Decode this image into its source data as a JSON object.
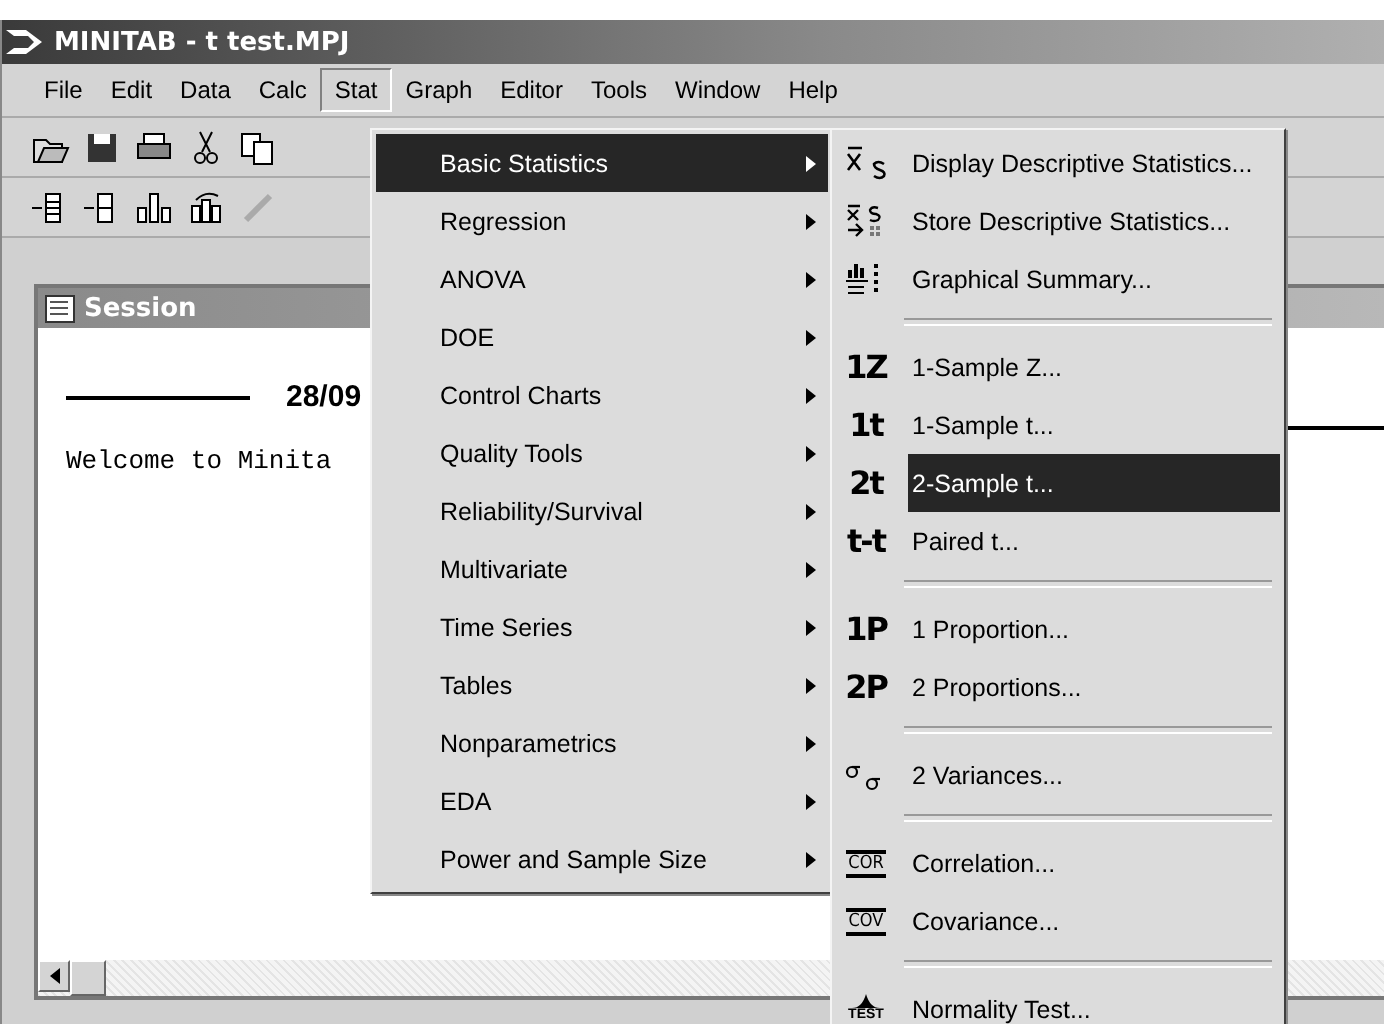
{
  "window": {
    "title": "MINITAB - t test.MPJ"
  },
  "menubar": [
    {
      "label": "File",
      "selected": false
    },
    {
      "label": "Edit",
      "selected": false
    },
    {
      "label": "Data",
      "selected": false
    },
    {
      "label": "Calc",
      "selected": false
    },
    {
      "label": "Stat",
      "selected": true
    },
    {
      "label": "Graph",
      "selected": false
    },
    {
      "label": "Editor",
      "selected": false
    },
    {
      "label": "Tools",
      "selected": false
    },
    {
      "label": "Window",
      "selected": false
    },
    {
      "label": "Help",
      "selected": false
    }
  ],
  "session": {
    "title": "Session",
    "date": "28/09",
    "welcome": "Welcome to Minita"
  },
  "stat_menu": [
    {
      "label": "Basic Statistics",
      "selected": true
    },
    {
      "label": "Regression",
      "selected": false
    },
    {
      "label": "ANOVA",
      "selected": false
    },
    {
      "label": "DOE",
      "selected": false
    },
    {
      "label": "Control Charts",
      "selected": false
    },
    {
      "label": "Quality Tools",
      "selected": false
    },
    {
      "label": "Reliability/Survival",
      "selected": false
    },
    {
      "label": "Multivariate",
      "selected": false
    },
    {
      "label": "Time Series",
      "selected": false
    },
    {
      "label": "Tables",
      "selected": false
    },
    {
      "label": "Nonparametrics",
      "selected": false
    },
    {
      "label": "EDA",
      "selected": false
    },
    {
      "label": "Power and Sample Size",
      "selected": false
    }
  ],
  "basic_statistics_menu": [
    {
      "kind": "xbar-item",
      "label": "Display Descriptive Statistics...",
      "selected": false
    },
    {
      "kind": "store-item",
      "label": "Store Descriptive Statistics...",
      "selected": false
    },
    {
      "kind": "summary-item",
      "label": "Graphical Summary...",
      "selected": false
    },
    {
      "kind": "separator"
    },
    {
      "kind": "item",
      "badge": "1Z",
      "label": "1-Sample Z...",
      "selected": false
    },
    {
      "kind": "item",
      "badge": "1t",
      "label": "1-Sample t...",
      "selected": false
    },
    {
      "kind": "item",
      "badge": "2t",
      "label": "2-Sample t...",
      "selected": true
    },
    {
      "kind": "item",
      "badge": "t-t",
      "label": "Paired t...",
      "selected": false
    },
    {
      "kind": "separator"
    },
    {
      "kind": "item",
      "badge": "1P",
      "label": "1 Proportion...",
      "selected": false
    },
    {
      "kind": "item",
      "badge": "2P",
      "label": "2 Proportions...",
      "selected": false
    },
    {
      "kind": "separator"
    },
    {
      "kind": "variance-item",
      "label": "2 Variances...",
      "selected": false
    },
    {
      "kind": "separator"
    },
    {
      "kind": "item",
      "boxed": "COR",
      "label": "Correlation...",
      "selected": false
    },
    {
      "kind": "item",
      "boxed": "COV",
      "label": "Covariance...",
      "selected": false
    },
    {
      "kind": "separator"
    },
    {
      "kind": "item",
      "test": "TEST",
      "label": "Normality Test...",
      "selected": false
    }
  ]
}
